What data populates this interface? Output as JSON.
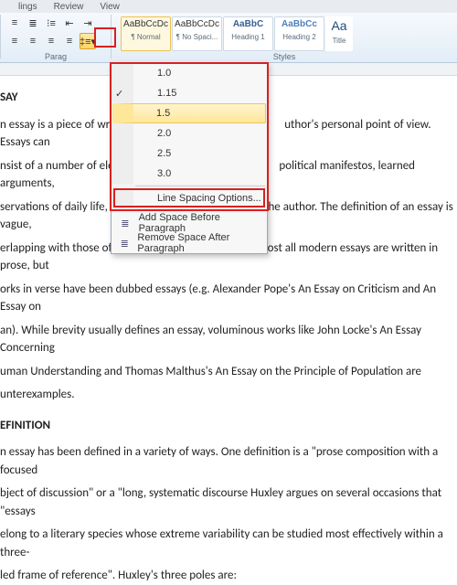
{
  "tabs": {
    "mailings": "lings",
    "review": "Review",
    "view": "View"
  },
  "groupLabels": {
    "paragraph": "Parag",
    "styles": "Styles"
  },
  "styles": [
    {
      "preview": "AaBbCcDc",
      "name": "¶ Normal"
    },
    {
      "preview": "AaBbCcDc",
      "name": "¶ No Spaci..."
    },
    {
      "preview": "AaBbC",
      "name": "Heading 1"
    },
    {
      "preview": "AaBbCc",
      "name": "Heading 2"
    },
    {
      "preview": "Aa",
      "name": "Title"
    }
  ],
  "spacingMenu": {
    "v10": "1.0",
    "v115": "1.15",
    "v15": "1.5",
    "v20": "2.0",
    "v25": "2.5",
    "v30": "3.0",
    "options": "Line Spacing Options...",
    "addBefore": "Add Space Before Paragraph",
    "removeAfter": "Remove Space After Paragraph"
  },
  "doc": {
    "h1": "SAY",
    "p1a": "n essay is a piece of writin",
    "p1b": "uthor's personal point of view. Essays can",
    "p2a": "nsist of a number of elen",
    "p2b": "political manifestos, learned arguments,",
    "p3": "servations of daily life, recollections, and reflections of the author. The definition of an essay is vague,",
    "p4": "erlapping with those of an article  and a short story. Almost all modern essays are written in prose, but",
    "p5": "orks in verse have been dubbed essays (e.g. Alexander Pope's An Essay on Criticism and An Essay on",
    "p6": "an). While brevity usually defines an essay, voluminous works like John Locke's An Essay Concerning",
    "p7": "uman Understanding and Thomas Malthus's An Essay on the Principle of Population are",
    "p8": "unterexamples.",
    "h2": "EFINITION",
    "p9": "n essay has been defined in a variety of ways. One definition is a \"prose composition with a focused",
    "p10": "bject of discussion\" or a \"long, systematic discourse Huxley argues on several occasions that \"essays",
    "p11": "elong to a literary species whose extreme variability can be studied most effectively within a three-",
    "p12": "led frame of reference\". Huxley's three poles are:"
  }
}
